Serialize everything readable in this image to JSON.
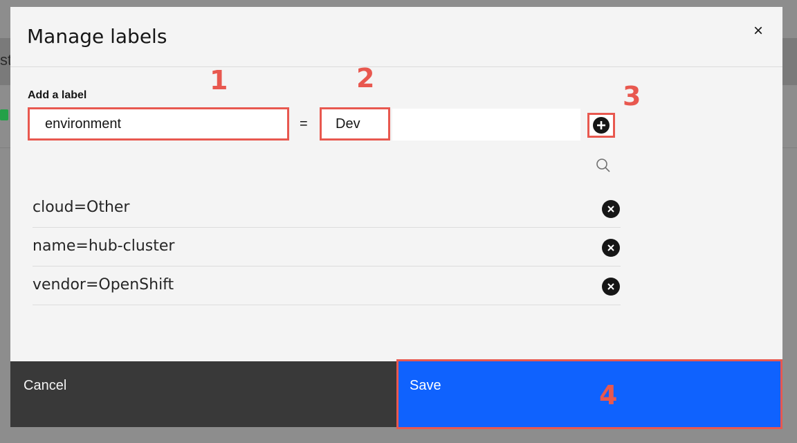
{
  "background": {
    "partial_text": "st"
  },
  "modal": {
    "title": "Manage labels",
    "close_symbol": "×",
    "add_label_heading": "Add a label",
    "key_input_value": "environment",
    "equals_sign": "=",
    "value_input_value": "Dev",
    "add_button_icon": "add-filled-icon",
    "search_icon": "search-icon",
    "labels": [
      {
        "text": "cloud=Other"
      },
      {
        "text": "name=hub-cluster"
      },
      {
        "text": "vendor=OpenShift"
      }
    ],
    "footer": {
      "cancel_label": "Cancel",
      "save_label": "Save"
    }
  },
  "annotations": [
    "1",
    "2",
    "3",
    "4"
  ],
  "colors": {
    "primary": "#0f62fe",
    "secondary": "#393939",
    "highlight": "#e8584f",
    "modal_bg": "#f4f4f4",
    "overlay": "#8d8d8d"
  }
}
